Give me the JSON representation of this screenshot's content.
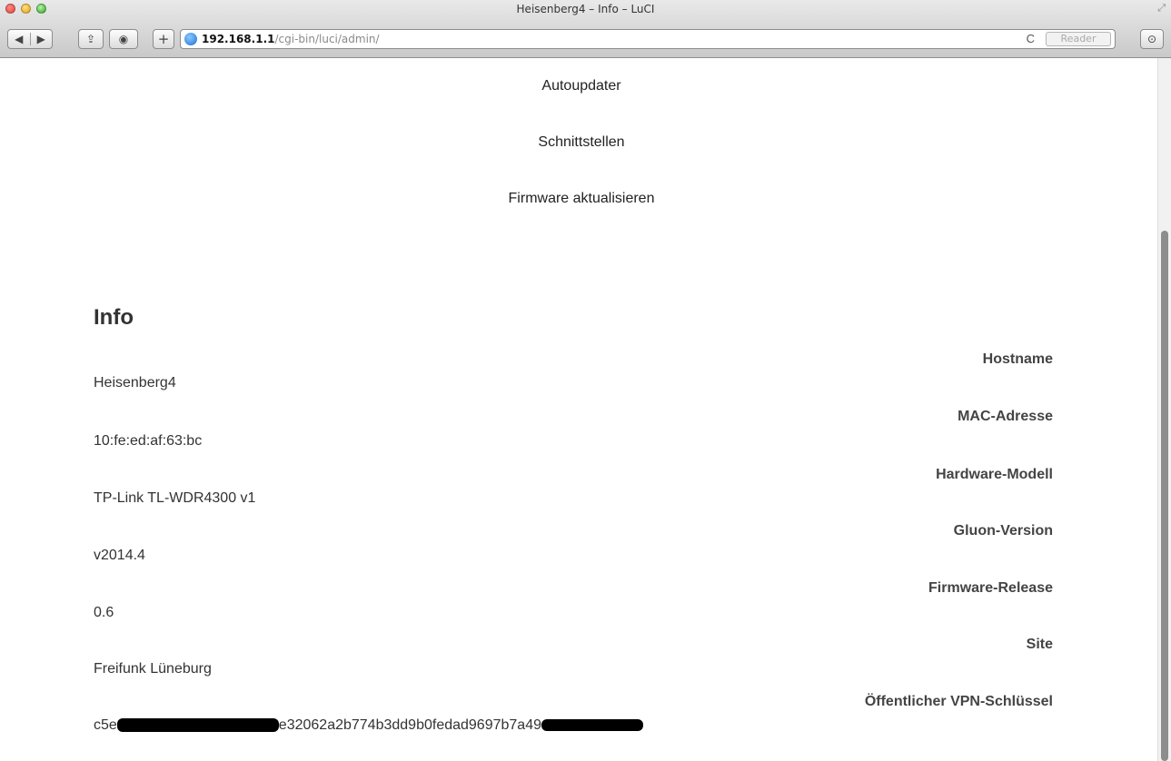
{
  "window": {
    "title": "Heisenberg4 – Info – LuCI"
  },
  "toolbar": {
    "back_glyph": "◀",
    "forward_glyph": "▶",
    "share_glyph": "⇪",
    "topsites_glyph": "◉",
    "new_tab_glyph": "+",
    "url_host": "192.168.1.1",
    "url_path": "/cgi-bin/luci/admin/",
    "reload_glyph": "C",
    "reader_label": "Reader",
    "download_glyph": "⊙"
  },
  "nav": {
    "items": [
      "Autoupdater",
      "Schnittstellen",
      "Firmware aktualisieren"
    ]
  },
  "info": {
    "heading": "Info",
    "rows": [
      {
        "label": "Hostname",
        "value": "Heisenberg4"
      },
      {
        "label": "MAC-Adresse",
        "value": "10:fe:ed:af:63:bc"
      },
      {
        "label": "Hardware-Modell",
        "value": "TP-Link TL-WDR4300 v1"
      },
      {
        "label": "Gluon-Version",
        "value": "v2014.4"
      },
      {
        "label": "Firmware-Release",
        "value": "0.6"
      },
      {
        "label": "Site",
        "value": "Freifunk Lüneburg"
      },
      {
        "label": "Öffentlicher VPN-Schlüssel",
        "value_visible_start": "c5e",
        "value_visible_middle": "e32062a2b774b3dd9b0fedad9697b7a49"
      }
    ]
  }
}
